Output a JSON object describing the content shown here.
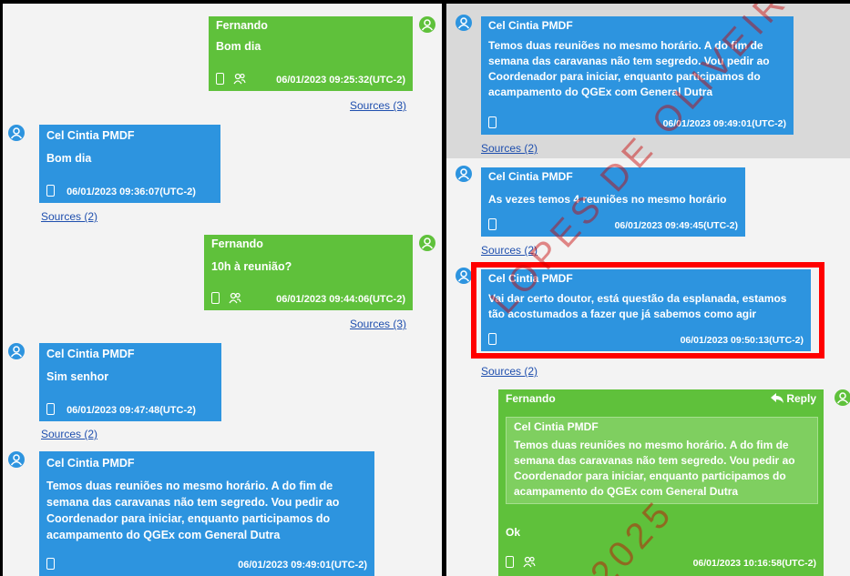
{
  "left": {
    "messages": [
      {
        "sender": "Fernando",
        "text": "Bom dia",
        "timestamp": "06/01/2023 09:25:32(UTC-2)",
        "sources": "Sources (3)"
      },
      {
        "sender": "Cel Cintia PMDF",
        "text": "Bom dia",
        "timestamp": "06/01/2023 09:36:07(UTC-2)",
        "sources": "Sources (2)"
      },
      {
        "sender": "Fernando",
        "text": "10h à reunião?",
        "timestamp": "06/01/2023 09:44:06(UTC-2)",
        "sources": "Sources (3)"
      },
      {
        "sender": "Cel Cintia PMDF",
        "text": "Sim senhor",
        "timestamp": "06/01/2023 09:47:48(UTC-2)",
        "sources": "Sources (2)"
      },
      {
        "sender": "Cel Cintia PMDF",
        "text": "Temos  duas reuniões no mesmo horário. A do fim de semana  das caravanas não tem segredo. Vou pedir ao Coordenador para iniciar, enquanto participamos do acampamento do QGEx com General Dutra",
        "timestamp": "06/01/2023 09:49:01(UTC-2)"
      }
    ]
  },
  "right": {
    "messages": [
      {
        "sender": "Cel Cintia PMDF",
        "text": "Temos  duas reuniões no mesmo horário. A do fim de semana  das caravanas não tem segredo. Vou pedir ao Coordenador para iniciar, enquanto participamos do acampamento do QGEx com General Dutra",
        "timestamp": "06/01/2023 09:49:01(UTC-2)",
        "sources": "Sources (2)"
      },
      {
        "sender": "Cel Cintia PMDF",
        "text": "As vezes temos 4 reuniões no mesmo horário",
        "timestamp": "06/01/2023 09:49:45(UTC-2)",
        "sources": "Sources (2)"
      },
      {
        "sender": "Cel Cintia PMDF",
        "text": "Vai dar certo doutor, está questão da esplanada, estamos tão acostumados a fazer que já sabemos como agir",
        "timestamp": "06/01/2023 09:50:13(UTC-2)",
        "sources": "Sources (2)"
      },
      {
        "sender": "Fernando",
        "reply_label": "Reply",
        "quote_sender": "Cel Cintia PMDF",
        "quote_text": "Temos  duas reuniões no mesmo horário. A do fim de semana  das caravanas não tem segredo. Vou pedir ao Coordenador para iniciar, enquanto participamos do acampamento do QGEx com General Dutra",
        "text": "Ok",
        "timestamp": "06/01/2023 10:16:58(UTC-2)"
      }
    ]
  },
  "watermark": {
    "line1": "LOPES DE OLIVEIRA",
    "line2": "2025"
  },
  "colors": {
    "blue_bubble": "#2d94df",
    "green_bubble": "#5fc13b",
    "highlight": "#ff0000",
    "link": "#1f4fae"
  },
  "icons": [
    "user-avatar-icon",
    "phone-device-icon",
    "group-icon",
    "reply-arrow-icon"
  ]
}
